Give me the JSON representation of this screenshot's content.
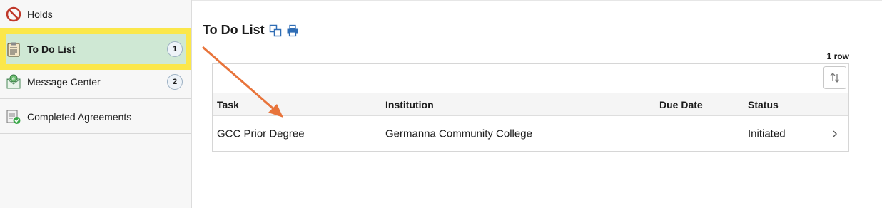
{
  "sidebar": {
    "items": [
      {
        "label": "Holds",
        "icon": "no-entry-icon"
      },
      {
        "label": "To Do List",
        "icon": "clipboard-icon",
        "count": "1"
      },
      {
        "label": "Message Center",
        "icon": "mail-icon",
        "count": "2"
      },
      {
        "label": "Completed Agreements",
        "icon": "agreement-check-icon"
      }
    ]
  },
  "main": {
    "title": "To Do List",
    "row_count": "1 row",
    "table": {
      "columns": [
        "Task",
        "Institution",
        "Due Date",
        "Status"
      ],
      "rows": [
        {
          "task": "GCC Prior Degree",
          "institution": "Germanna Community College",
          "due_date": "",
          "status": "Initiated"
        }
      ]
    }
  },
  "colors": {
    "highlight": "#fbe74a",
    "selected_bg": "#cfe8d4",
    "annotation_arrow": "#e8743b",
    "icon_blue": "#2f6db5"
  }
}
